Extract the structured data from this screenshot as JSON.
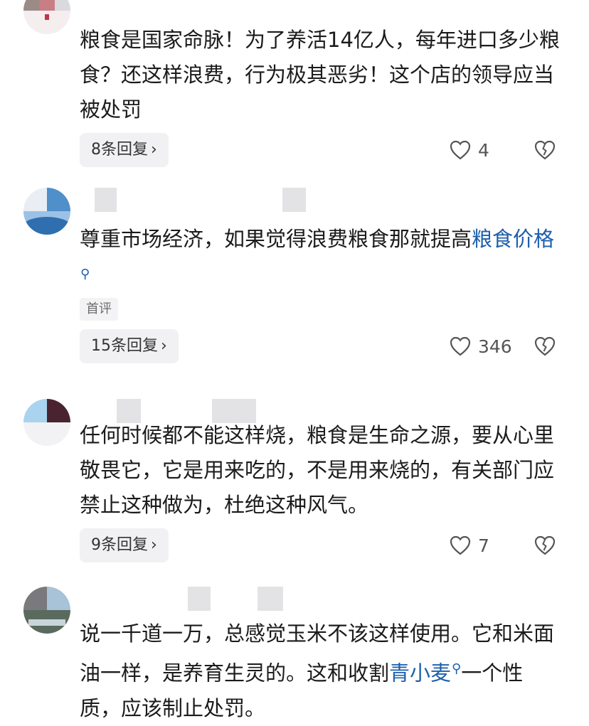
{
  "comments": [
    {
      "text": "粮食是国家命脉！为了养活14亿人，每年进口多少粮食？还这样浪费，行为极其恶劣！这个店的领导应当被处罚",
      "replies_label": "8条回复",
      "likes": "4",
      "avatar_colors": [
        "#9a8b86",
        "#c97d85",
        "#d9d9de"
      ]
    },
    {
      "text": "尊重市场经济，如果觉得浪费粮食那就提高",
      "link": "粮食价格",
      "text_after": "",
      "badge": "首评",
      "replies_label": "15条回复",
      "likes": "346",
      "avatar_colors": [
        "#4f8fca",
        "#9bc2e5",
        "#e7eef6"
      ]
    },
    {
      "text": "任何时候都不能这样烧，粮食是生命之源，要从心里敬畏它，它是用来吃的，不是用来烧的，有关部门应禁止这种做为，杜绝这种风气。",
      "replies_label": "9条回复",
      "likes": "7",
      "avatar_colors": [
        "#a9d3ef",
        "#4a2330",
        "#dde6ee"
      ]
    },
    {
      "text": "说一千道一万，总感觉玉米不该这样使用。它和米面油一样，是养育生灵的。这和收割",
      "link": "青小麦",
      "text_after": "一个性质，应该制止处罚。",
      "avatar_colors": [
        "#7a7a7c",
        "#a8c2d8",
        "#5a6a5e"
      ]
    }
  ],
  "icons": {
    "like": "heart-outline-icon",
    "dislike": "broken-heart-icon",
    "search": "search-icon",
    "chevron": "chevron-right-icon"
  },
  "colors": {
    "link": "#1c5fad",
    "text": "#1b1b1b",
    "pill_bg": "#f1f1f3"
  }
}
